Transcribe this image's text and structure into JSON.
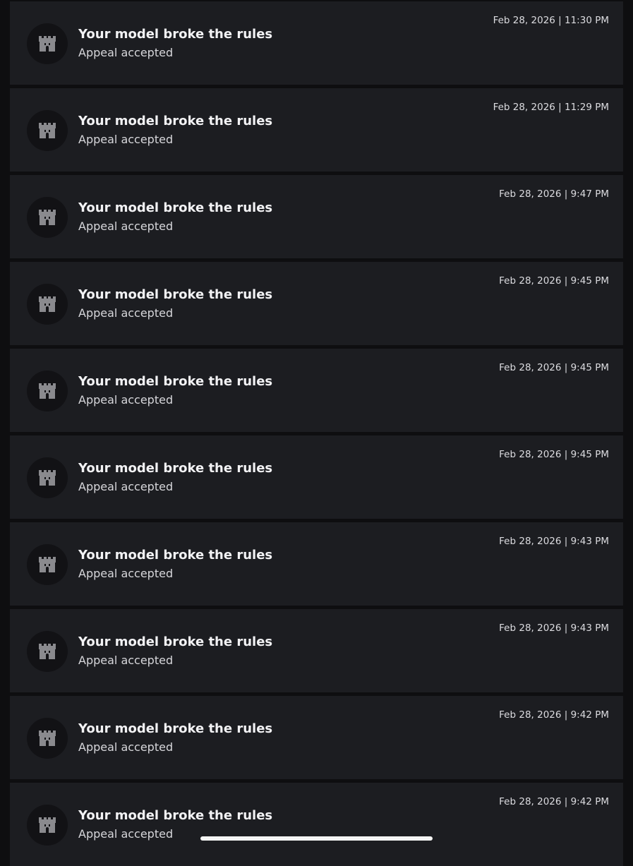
{
  "notifications": [
    {
      "icon": "castle-icon",
      "title": "Your model broke the rules",
      "subtitle": "Appeal accepted",
      "timestamp": "Feb 28, 2026 | 11:30 PM"
    },
    {
      "icon": "castle-icon",
      "title": "Your model broke the rules",
      "subtitle": "Appeal accepted",
      "timestamp": "Feb 28, 2026 | 11:29 PM"
    },
    {
      "icon": "castle-icon",
      "title": "Your model broke the rules",
      "subtitle": "Appeal accepted",
      "timestamp": "Feb 28, 2026 | 9:47 PM"
    },
    {
      "icon": "castle-icon",
      "title": "Your model broke the rules",
      "subtitle": "Appeal accepted",
      "timestamp": "Feb 28, 2026 | 9:45 PM"
    },
    {
      "icon": "castle-icon",
      "title": "Your model broke the rules",
      "subtitle": "Appeal accepted",
      "timestamp": "Feb 28, 2026 | 9:45 PM"
    },
    {
      "icon": "castle-icon",
      "title": "Your model broke the rules",
      "subtitle": "Appeal accepted",
      "timestamp": "Feb 28, 2026 | 9:45 PM"
    },
    {
      "icon": "castle-icon",
      "title": "Your model broke the rules",
      "subtitle": "Appeal accepted",
      "timestamp": "Feb 28, 2026 | 9:43 PM"
    },
    {
      "icon": "castle-icon",
      "title": "Your model broke the rules",
      "subtitle": "Appeal accepted",
      "timestamp": "Feb 28, 2026 | 9:43 PM"
    },
    {
      "icon": "castle-icon",
      "title": "Your model broke the rules",
      "subtitle": "Appeal accepted",
      "timestamp": "Feb 28, 2026 | 9:42 PM"
    },
    {
      "icon": "castle-icon",
      "title": "Your model broke the rules",
      "subtitle": "Appeal accepted",
      "timestamp": "Feb 28, 2026 | 9:42 PM"
    }
  ],
  "colors": {
    "page_background": "#0e0e10",
    "card_background": "#1c1d21",
    "avatar_background": "#121215",
    "icon_color": "#8a8a8e",
    "title_color": "#f2f2f4"
  }
}
